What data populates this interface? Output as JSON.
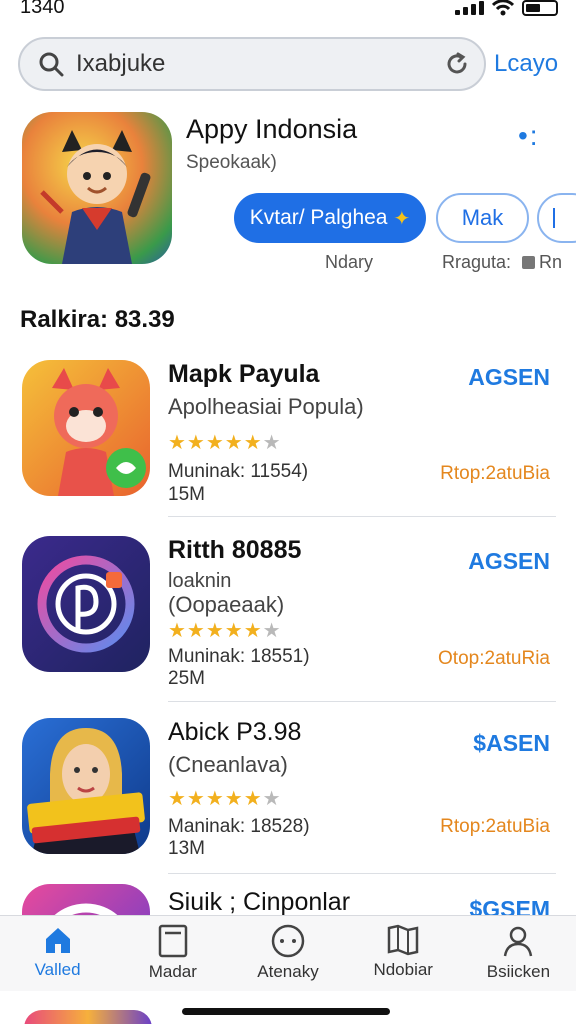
{
  "status": {
    "time": "1340"
  },
  "search": {
    "query": "Ixabjuke",
    "cancel_label": "Lcayo"
  },
  "featured": {
    "title": "Appy Indonsia",
    "subtitle": "Speokaak)",
    "primary_button": "Kvtar/ Palghea",
    "secondary_button": "Mak",
    "label_left": "Ndary",
    "label_right": "Rraguta:",
    "label_right_extra": "Rn"
  },
  "rankings": {
    "heading": "Ralkira: 83.39",
    "apps": [
      {
        "name": "Mapk Payula",
        "sub1": "Apolheasiai Popula)",
        "sub2": "",
        "rating": 4,
        "meta1": "Muninak: 11554)",
        "meta2": "15M",
        "action": "AGSEN",
        "extra": "Rtop:2atuBia",
        "icon": "fox-character-icon",
        "colors": [
          "#f5c03a",
          "#e8622e"
        ]
      },
      {
        "name": "Ritth 80885",
        "sub1": "loaknin",
        "sub2": "(Oopaeaak)",
        "rating": 4,
        "meta1": "Muninak: 18551)",
        "meta2": "25M",
        "action": "AGSEN",
        "extra": "Otop:2atuRia",
        "icon": "music-disc-icon",
        "colors": [
          "#3b2a8c",
          "#1f2360"
        ]
      },
      {
        "name": "Abick P3.98",
        "sub1": "(Cneanlava)",
        "sub2": "",
        "rating": 4,
        "meta1": "Maninak: 18528)",
        "meta2": "13M",
        "action": "$ASEN",
        "extra": "Rtop:2atuBia",
        "icon": "portrait-game-icon",
        "colors": [
          "#2a6fd6",
          "#0f3a8a"
        ]
      },
      {
        "name": "Siuik ; Cinponlar",
        "sub1": "",
        "sub2": "",
        "rating": 0,
        "meta1": "",
        "meta2": "",
        "action": "$GSEM",
        "extra": "",
        "icon": "circle-app-icon",
        "colors": [
          "#e84a9c",
          "#5a3ad0"
        ]
      }
    ]
  },
  "tabs": [
    {
      "label": "Valled",
      "icon": "home-icon",
      "active": true
    },
    {
      "label": "Madar",
      "icon": "tablet-icon",
      "active": false
    },
    {
      "label": "Atenaky",
      "icon": "chat-dots-icon",
      "active": false
    },
    {
      "label": "Ndobiar",
      "icon": "book-map-icon",
      "active": false
    },
    {
      "label": "Bsiicken",
      "icon": "person-icon",
      "active": false
    }
  ],
  "accent": "#1f7ae0"
}
